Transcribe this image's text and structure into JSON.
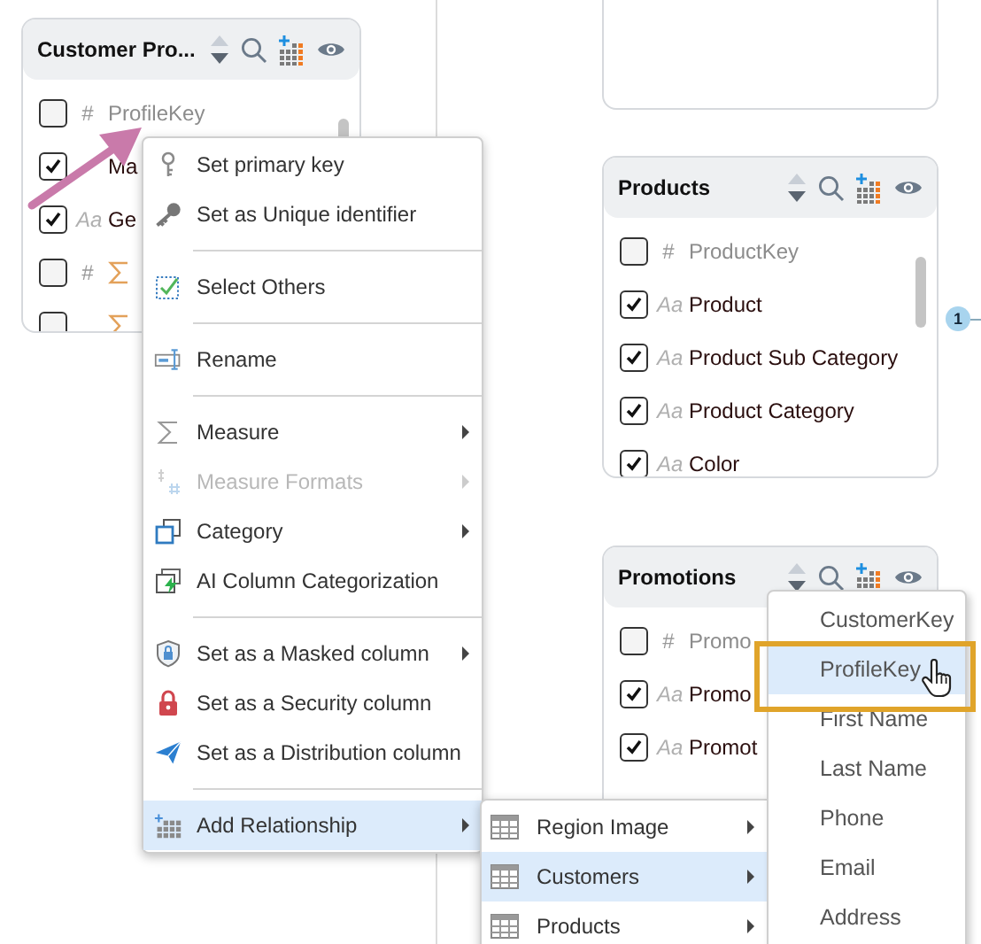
{
  "tables": [
    {
      "title": "Customer Pro...",
      "fields": [
        {
          "kind": "key",
          "glyph": "#",
          "name": "ProfileKey",
          "checked": false
        },
        {
          "kind": "text",
          "name": "Ma",
          "checked": true
        },
        {
          "kind": "text",
          "glyph": "Aa",
          "name": "Ge",
          "checked": true
        },
        {
          "kind": "measure",
          "glyph": "#",
          "checked": false
        },
        {
          "kind": "measure",
          "checked": false
        }
      ]
    },
    {
      "title": "Products",
      "fields": [
        {
          "kind": "key",
          "glyph": "#",
          "name": "ProductKey",
          "checked": false
        },
        {
          "kind": "text",
          "glyph": "Aa",
          "name": "Product",
          "checked": true
        },
        {
          "kind": "text",
          "glyph": "Aa",
          "name": "Product Sub Category",
          "checked": true
        },
        {
          "kind": "text",
          "glyph": "Aa",
          "name": "Product Category",
          "checked": true
        },
        {
          "kind": "text",
          "glyph": "Aa",
          "name": "Color",
          "checked": true
        }
      ]
    },
    {
      "title": "Promotions",
      "fields": [
        {
          "kind": "key",
          "glyph": "#",
          "name": "Promo",
          "checked": false
        },
        {
          "kind": "text",
          "glyph": "Aa",
          "name": "Promo",
          "checked": true
        },
        {
          "kind": "text",
          "glyph": "Aa",
          "name": "Promot",
          "checked": true
        }
      ]
    }
  ],
  "relationship_badge": "1",
  "context_menu": [
    {
      "kind": "item",
      "label": "Set primary key",
      "submenu": false,
      "disabled": false,
      "selected": false
    },
    {
      "kind": "item",
      "label": "Set as Unique identifier",
      "submenu": false,
      "disabled": false,
      "selected": false
    },
    {
      "kind": "separator"
    },
    {
      "kind": "item",
      "label": "Select Others",
      "submenu": false,
      "disabled": false,
      "selected": false
    },
    {
      "kind": "separator"
    },
    {
      "kind": "item",
      "label": "Rename",
      "submenu": false,
      "disabled": false,
      "selected": false
    },
    {
      "kind": "separator"
    },
    {
      "kind": "item",
      "label": "Measure",
      "submenu": true,
      "disabled": false,
      "selected": false
    },
    {
      "kind": "item",
      "label": "Measure Formats",
      "submenu": true,
      "disabled": true,
      "selected": false
    },
    {
      "kind": "item",
      "label": "Category",
      "submenu": true,
      "disabled": false,
      "selected": false
    },
    {
      "kind": "item",
      "label": "AI Column Categorization",
      "submenu": false,
      "disabled": false,
      "selected": false
    },
    {
      "kind": "separator"
    },
    {
      "kind": "item",
      "label": "Set as a Masked column",
      "submenu": true,
      "disabled": false,
      "selected": false
    },
    {
      "kind": "item",
      "label": "Set as a Security column",
      "submenu": false,
      "disabled": false,
      "selected": false
    },
    {
      "kind": "item",
      "label": "Set as a Distribution column",
      "submenu": false,
      "disabled": false,
      "selected": false
    },
    {
      "kind": "separator"
    },
    {
      "kind": "item",
      "label": "Add Relationship",
      "submenu": true,
      "disabled": false,
      "selected": true
    }
  ],
  "table_submenu": [
    {
      "label": "Region Image",
      "selected": false
    },
    {
      "label": "Customers",
      "selected": true
    },
    {
      "label": "Products",
      "selected": false
    }
  ],
  "column_dropdown": [
    {
      "label": "CustomerKey",
      "selected": false
    },
    {
      "label": "ProfileKey",
      "selected": true
    },
    {
      "label": "First Name",
      "selected": false
    },
    {
      "label": "Last Name",
      "selected": false
    },
    {
      "label": "Phone",
      "selected": false
    },
    {
      "label": "Email",
      "selected": false
    },
    {
      "label": "Address",
      "selected": false
    }
  ]
}
